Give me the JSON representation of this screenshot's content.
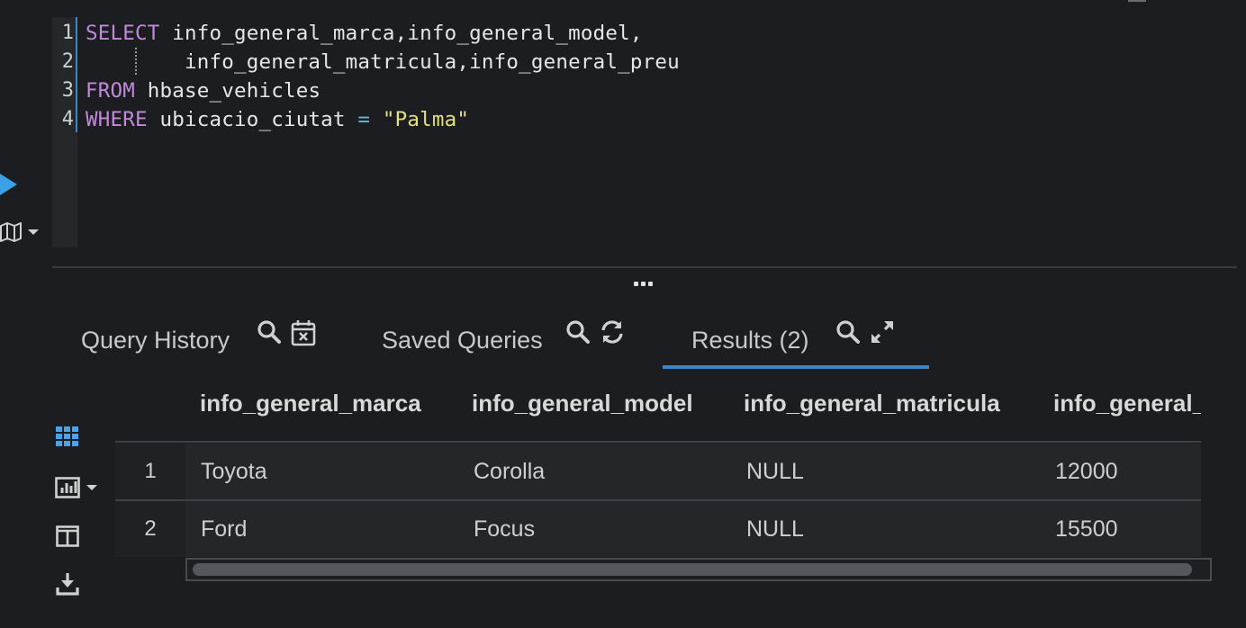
{
  "editor": {
    "line_numbers": [
      "1",
      "2",
      "3",
      "4"
    ],
    "lines": [
      [
        {
          "t": "SELECT",
          "c": "kw"
        },
        {
          "t": " info_general_marca,info_general_model,",
          "c": ""
        }
      ],
      [
        {
          "t": "        info_general_matricula,info_general_preu",
          "c": ""
        }
      ],
      [
        {
          "t": "FROM",
          "c": "kw"
        },
        {
          "t": " hbase_vehicles",
          "c": ""
        }
      ],
      [
        {
          "t": "WHERE",
          "c": "kw"
        },
        {
          "t": " ubicacio_ciutat ",
          "c": ""
        },
        {
          "t": "=",
          "c": "op"
        },
        {
          "t": " ",
          "c": ""
        },
        {
          "t": "\"Palma\"",
          "c": "str"
        }
      ]
    ]
  },
  "toolbar": {
    "run_icon": "play-icon",
    "map_icon": "map-icon",
    "map_dropdown_icon": "caret-down-icon"
  },
  "tabs": {
    "history": {
      "label": "Query History",
      "icons": [
        "search-icon",
        "calendar-clear-icon"
      ]
    },
    "saved": {
      "label": "Saved Queries",
      "icons": [
        "search-icon",
        "refresh-icon"
      ]
    },
    "results": {
      "label": "Results (2)",
      "icons": [
        "search-icon",
        "expand-icon"
      ],
      "active": true
    }
  },
  "side_tools": [
    "grid-icon",
    "bar-chart-icon",
    "columns-icon",
    "download-icon"
  ],
  "results": {
    "columns": [
      "info_general_marca",
      "info_general_model",
      "info_general_matricula",
      "info_general_"
    ],
    "rows": [
      {
        "index": "1",
        "cells": [
          "Toyota",
          "Corolla",
          "NULL",
          "12000"
        ]
      },
      {
        "index": "2",
        "cells": [
          "Ford",
          "Focus",
          "NULL",
          "15500"
        ]
      }
    ]
  },
  "colors": {
    "background": "#1c1d20",
    "keyword": "#c18ad8",
    "operator": "#56c1d4",
    "string": "#e4e07a",
    "accent": "#3b86c4",
    "run": "#3ba0e6"
  }
}
